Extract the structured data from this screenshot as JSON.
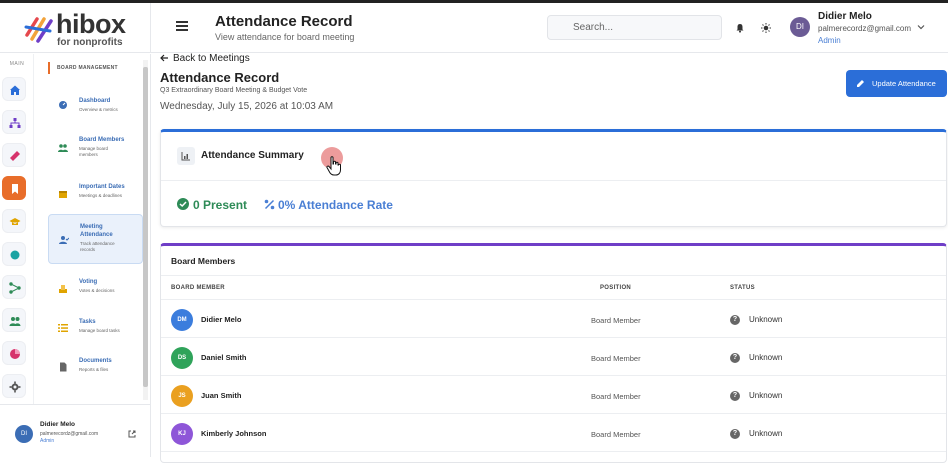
{
  "brand": {
    "logo_text": "hibox",
    "logo_sub": "for nonprofits"
  },
  "header": {
    "title": "Attendance Record",
    "subtitle": "View attendance for board meeting",
    "search_placeholder": "Search...",
    "user_name": "Didier Melo",
    "user_email": "palmerecordz@gmail.com",
    "user_role": "Admin",
    "user_initials": "DI"
  },
  "rail": {
    "label": "MAIN",
    "items": [
      {
        "icon": "home-icon",
        "color": "#2b6ed8"
      },
      {
        "icon": "org-chart-icon",
        "color": "#6f3ec7"
      },
      {
        "icon": "ticket-icon",
        "color": "#d6336c"
      },
      {
        "icon": "bookmark-icon",
        "color": "#e86d2a"
      },
      {
        "icon": "graduation-icon",
        "color": "#e0a400"
      },
      {
        "icon": "circle-icon",
        "color": "#1aa3a3"
      },
      {
        "icon": "network-icon",
        "color": "#2e8b57"
      },
      {
        "icon": "users-icon",
        "color": "#2e8b57"
      },
      {
        "icon": "pie-chart-icon",
        "color": "#d6336c"
      },
      {
        "icon": "gear-icon",
        "color": "#555555"
      }
    ]
  },
  "sidebar": {
    "section": "BOARD MANAGEMENT",
    "items": [
      {
        "label": "Dashboard",
        "desc": "Overview & metrics",
        "icon": "dashboard-icon"
      },
      {
        "label": "Board Members",
        "desc": "Manage board members",
        "icon": "users-icon"
      },
      {
        "label": "Important Dates",
        "desc": "Meetings & deadlines",
        "icon": "calendar-icon"
      },
      {
        "label": "Meeting Attendance",
        "desc": "Track attendance records",
        "icon": "user-check-icon"
      },
      {
        "label": "Voting",
        "desc": "Votes & decisions",
        "icon": "vote-icon"
      },
      {
        "label": "Tasks",
        "desc": "Manage board tasks",
        "icon": "list-icon"
      },
      {
        "label": "Documents",
        "desc": "Reports & files",
        "icon": "document-icon"
      }
    ],
    "footer": {
      "name": "Didier Melo",
      "email": "palmerecordz@gmail.com",
      "role": "Admin",
      "initials": "DI"
    }
  },
  "main": {
    "back_label": "Back to Meetings",
    "title": "Attendance Record",
    "subtitle": "Q3 Extraordinary Board Meeting & Budget Vote",
    "date": "Wednesday, July 15, 2026 at 10:03 AM",
    "update_label": "Update Attendance",
    "summary": {
      "title": "Attendance Summary",
      "present": "0 Present",
      "rate": "0% Attendance Rate"
    },
    "members": {
      "title": "Board Members",
      "headers": [
        "BOARD MEMBER",
        "POSITION",
        "STATUS"
      ],
      "rows": [
        {
          "initials": "DM",
          "name": "Didier Melo",
          "position": "Board Member",
          "status": "Unknown",
          "color": "#3b7ddd"
        },
        {
          "initials": "DS",
          "name": "Daniel Smith",
          "position": "Board Member",
          "status": "Unknown",
          "color": "#2fa35a"
        },
        {
          "initials": "JS",
          "name": "Juan Smith",
          "position": "Board Member",
          "status": "Unknown",
          "color": "#eaa020"
        },
        {
          "initials": "KJ",
          "name": "Kimberly Johnson",
          "position": "Board Member",
          "status": "Unknown",
          "color": "#8e56d8"
        }
      ]
    }
  }
}
